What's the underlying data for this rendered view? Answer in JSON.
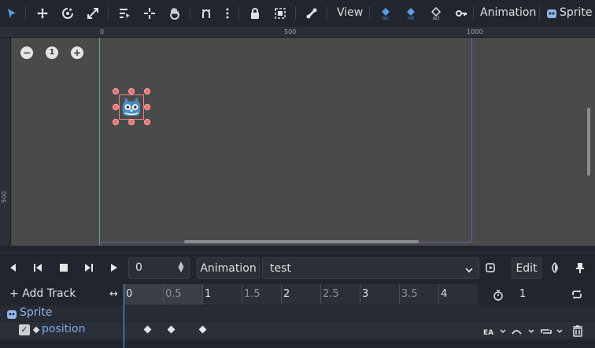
{
  "toolbar": {
    "view_label": "View",
    "animation_label": "Animation",
    "sprite_label": "Sprite",
    "accent_color": "#5a9ee8"
  },
  "viewport": {
    "ruler_top_ticks": [
      "0",
      "500",
      "1000"
    ],
    "ruler_left_ticks": [
      "500"
    ],
    "zoom_minus": "−",
    "zoom_level": "1",
    "zoom_plus": "+"
  },
  "anim": {
    "time_value": "0",
    "animation_button": "Animation",
    "current_animation": "test",
    "edit_button": "Edit",
    "add_track": "Add Track",
    "timeline_ticks": [
      "0",
      "0.5",
      "1",
      "1.5",
      "2",
      "2.5",
      "3",
      "3.5",
      "4"
    ],
    "snap_value": "1",
    "tracks": {
      "node_name": "Sprite",
      "property_name": "position"
    }
  }
}
